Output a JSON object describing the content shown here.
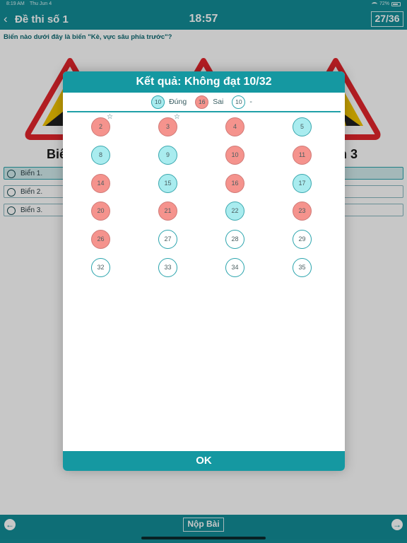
{
  "status_bar": {
    "time": "8:19 AM",
    "date": "Thu Jun 4",
    "battery": "72%"
  },
  "header": {
    "back_icon": "chevron-left",
    "title": "Đề thi số 1",
    "clock": "18:57",
    "counter": "27/36"
  },
  "question": {
    "text": "Biển nào dưới đây là biển \"Kè, vực sâu phía trước\"?",
    "sign_labels": [
      "Biể",
      "n 3"
    ],
    "options": [
      {
        "label": "Biển 1.",
        "selected": true
      },
      {
        "label": "Biển 2.",
        "selected": false
      },
      {
        "label": "Biển 3.",
        "selected": false
      }
    ]
  },
  "footer": {
    "submit_label": "Nộp Bài",
    "prev_icon": "arrow-left",
    "next_icon": "arrow-right"
  },
  "modal": {
    "title": "Kết quả: Không đạt 10/32",
    "legend": {
      "correct_count": "10",
      "correct_label": "Đúng",
      "wrong_count": "16",
      "wrong_label": "Sai",
      "unanswered_count": "10",
      "unanswered_label": "-"
    },
    "cells": [
      {
        "n": "2",
        "s": "wrong",
        "star": true
      },
      {
        "n": "3",
        "s": "wrong",
        "star": true
      },
      {
        "n": "4",
        "s": "wrong",
        "star": false
      },
      {
        "n": "5",
        "s": "correct",
        "star": false
      },
      {
        "n": "8",
        "s": "correct",
        "star": false
      },
      {
        "n": "9",
        "s": "correct",
        "star": false
      },
      {
        "n": "10",
        "s": "wrong",
        "star": false
      },
      {
        "n": "11",
        "s": "wrong",
        "star": false
      },
      {
        "n": "14",
        "s": "wrong",
        "star": false
      },
      {
        "n": "15",
        "s": "correct",
        "star": false
      },
      {
        "n": "16",
        "s": "wrong",
        "star": false
      },
      {
        "n": "17",
        "s": "correct",
        "star": false
      },
      {
        "n": "20",
        "s": "wrong",
        "star": false
      },
      {
        "n": "21",
        "s": "wrong",
        "star": false
      },
      {
        "n": "22",
        "s": "correct",
        "star": false
      },
      {
        "n": "23",
        "s": "wrong",
        "star": false
      },
      {
        "n": "26",
        "s": "wrong",
        "star": false
      },
      {
        "n": "27",
        "s": "unanswered",
        "star": false
      },
      {
        "n": "28",
        "s": "unanswered",
        "star": false
      },
      {
        "n": "29",
        "s": "unanswered",
        "star": false
      },
      {
        "n": "32",
        "s": "unanswered",
        "star": false
      },
      {
        "n": "33",
        "s": "unanswered",
        "star": false
      },
      {
        "n": "34",
        "s": "unanswered",
        "star": false
      },
      {
        "n": "35",
        "s": "unanswered",
        "star": false
      }
    ],
    "ok_label": "OK"
  },
  "colors": {
    "primary": "#1598a1",
    "correct": "#a9ecef",
    "wrong": "#f5938d"
  }
}
